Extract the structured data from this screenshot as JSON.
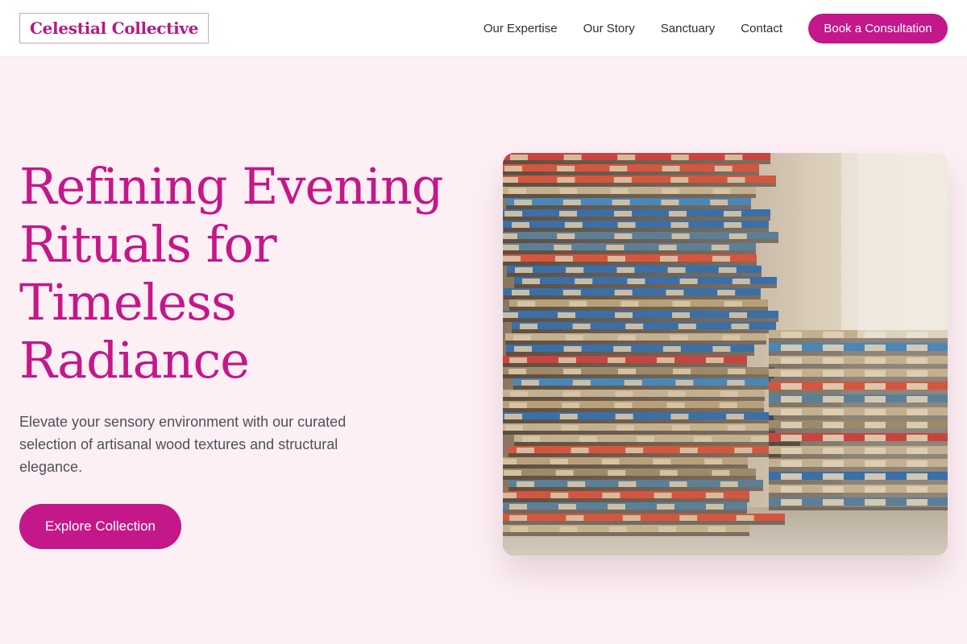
{
  "brand": {
    "name": "Celestial Collective"
  },
  "nav": {
    "items": [
      "Our Expertise",
      "Our Story",
      "Sanctuary",
      "Contact"
    ],
    "cta_label": "Book a Consultation"
  },
  "hero": {
    "title_lines": [
      "Refining Evening",
      "Rituals for",
      "Timeless",
      "Radiance"
    ],
    "description": "Elevate your sensory environment with our curated selection of artisanal wood textures and structural elegance.",
    "button_label": "Explore Collection"
  },
  "image": {
    "subject": "stacked-wooden-pallets-photo"
  },
  "colors": {
    "accent": "#c4178a",
    "background": "#fdf0f5",
    "header_bg": "#ffffff",
    "text": "#4f4f57"
  }
}
